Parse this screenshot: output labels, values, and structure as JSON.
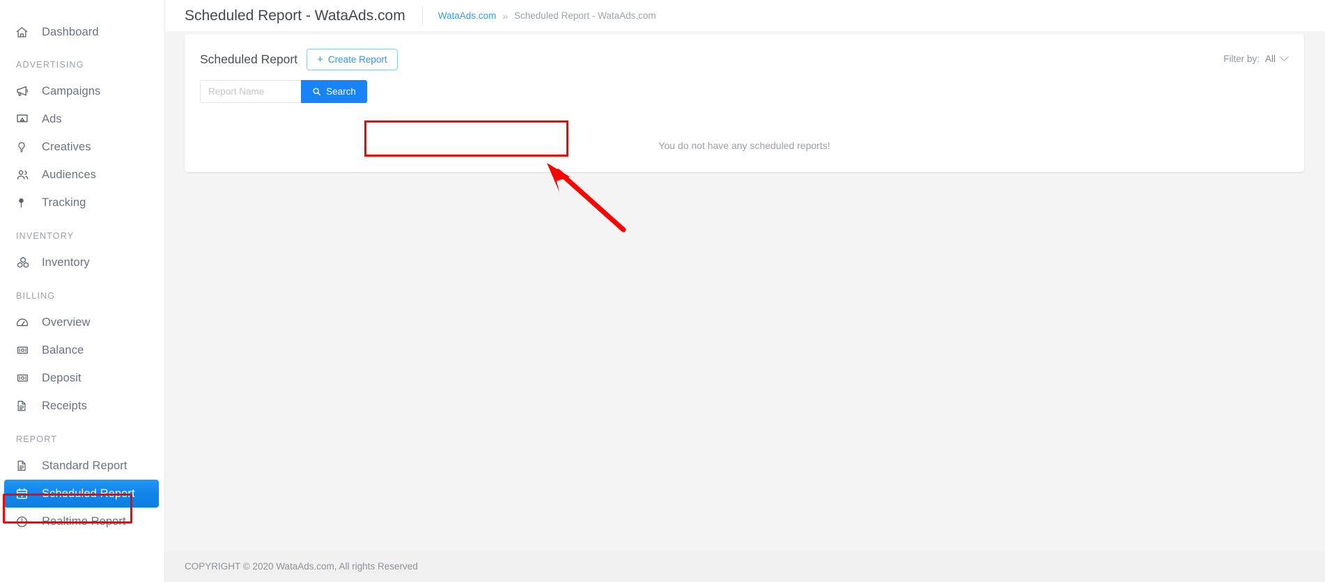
{
  "header": {
    "page_title": "Scheduled Report - WataAds.com",
    "breadcrumb": {
      "root_label": "WataAds.com",
      "separator": "»",
      "current_label": "Scheduled Report - WataAds.com"
    }
  },
  "sidebar": {
    "items": [
      {
        "label": "Dashboard",
        "icon": "home-icon",
        "type": "link",
        "active": false
      },
      {
        "label": "ADVERTISING",
        "type": "section"
      },
      {
        "label": "Campaigns",
        "icon": "megaphone-icon",
        "type": "link",
        "active": false
      },
      {
        "label": "Ads",
        "icon": "ad-display-icon",
        "type": "link",
        "active": false
      },
      {
        "label": "Creatives",
        "icon": "lightbulb-icon",
        "type": "link",
        "active": false
      },
      {
        "label": "Audiences",
        "icon": "users-icon",
        "type": "link",
        "active": false
      },
      {
        "label": "Tracking",
        "icon": "map-pin-icon",
        "type": "link",
        "active": false
      },
      {
        "label": "INVENTORY",
        "type": "section"
      },
      {
        "label": "Inventory",
        "icon": "boxes-icon",
        "type": "link",
        "active": false
      },
      {
        "label": "BILLING",
        "type": "section"
      },
      {
        "label": "Overview",
        "icon": "gauge-icon",
        "type": "link",
        "active": false
      },
      {
        "label": "Balance",
        "icon": "banknote-icon",
        "type": "link",
        "active": false
      },
      {
        "label": "Deposit",
        "icon": "banknote-icon",
        "type": "link",
        "active": false
      },
      {
        "label": "Receipts",
        "icon": "document-icon",
        "type": "link",
        "active": false
      },
      {
        "label": "REPORT",
        "type": "section"
      },
      {
        "label": "Standard Report",
        "icon": "document-icon",
        "type": "link",
        "active": false
      },
      {
        "label": "Scheduled Report",
        "icon": "calendar-plus-icon",
        "type": "link",
        "active": true
      },
      {
        "label": "Realtime Report",
        "icon": "clock-icon",
        "type": "link",
        "active": false
      }
    ],
    "section_labels": {
      "advertising": "ADVERTISING",
      "inventory": "INVENTORY",
      "billing": "BILLING",
      "report": "REPORT"
    },
    "labels": {
      "dashboard": "Dashboard",
      "campaigns": "Campaigns",
      "ads": "Ads",
      "creatives": "Creatives",
      "audiences": "Audiences",
      "tracking": "Tracking",
      "inventory": "Inventory",
      "overview": "Overview",
      "balance": "Balance",
      "deposit": "Deposit",
      "receipts": "Receipts",
      "standard_report": "Standard Report",
      "scheduled_report": "Scheduled Report",
      "realtime_report": "Realtime Report"
    }
  },
  "card": {
    "title": "Scheduled Report",
    "create_button_label": "Create Report",
    "create_button_plus": "+",
    "filter": {
      "label": "Filter by:",
      "selected": "All",
      "options": [
        "All"
      ]
    },
    "search": {
      "placeholder": "Report Name",
      "value": "",
      "button_label": "Search"
    },
    "empty_message": "You do not have any scheduled reports!"
  },
  "footer": {
    "copyright": "COPYRIGHT © 2020 WataAds.com, All rights Reserved"
  },
  "annotations": {
    "highlight_color": "#ff0000",
    "arrow_color": "#ff0000",
    "highlighted_elements": [
      "search-group",
      "sidebar-item-scheduled-report"
    ]
  },
  "colors": {
    "accent_blue": "#1a82f7",
    "link_blue": "#3d9ae8",
    "active_nav": "#1184ea",
    "page_bg": "#f4f4f4",
    "card_bg": "#ffffff",
    "muted_text": "#9aa0a7"
  }
}
